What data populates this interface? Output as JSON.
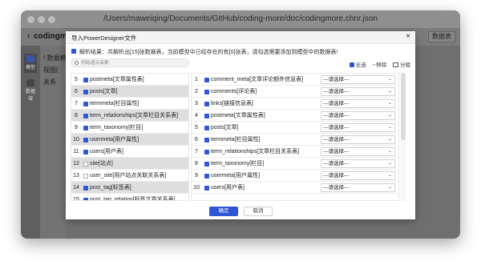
{
  "window": {
    "title": "/Users/maweiqing/Documents/GitHub/coding-more/doc/codingmore.chnr.json"
  },
  "app": {
    "name": "codingmo",
    "back_glyph": "‹",
    "header_button": "数据表",
    "rail": [
      {
        "label": "模型"
      },
      {
        "label": "数据域"
      }
    ],
    "tree": [
      "! 数据模",
      "视图(",
      "关系"
    ]
  },
  "modal": {
    "title": "导入PowerDesigner文件",
    "close_glyph": "×",
    "result_text": "解析结果：共解析出[15]张数据表，当前模型中已经存在的有[0]张表，请勾选需要添加到模型中的数据表!",
    "search_placeholder": "代码/显示名称",
    "select_all_label": "全选",
    "remove_label": "移除",
    "group_label": "分组",
    "ok_label": "确定",
    "cancel_label": "取消",
    "select_placeholder": "---请选择---",
    "left_rows": [
      {
        "index": "5",
        "checked": true,
        "name": "postmeta[文章属性表]",
        "selected": false
      },
      {
        "index": "6",
        "checked": true,
        "name": "posts[文章]",
        "selected": true
      },
      {
        "index": "7",
        "checked": true,
        "name": "termmeta[栏目属性]",
        "selected": false
      },
      {
        "index": "8",
        "checked": true,
        "name": "term_relationships[文章栏目关系表]",
        "selected": true
      },
      {
        "index": "9",
        "checked": true,
        "name": "term_taxonomy[栏目]",
        "selected": false
      },
      {
        "index": "10",
        "checked": true,
        "name": "usermeta[用户属性]",
        "selected": true
      },
      {
        "index": "11",
        "checked": true,
        "name": "users[用户表]",
        "selected": false
      },
      {
        "index": "12",
        "checked": false,
        "name": "site[站点]",
        "selected": true
      },
      {
        "index": "13",
        "checked": false,
        "name": "user_site[用户站点关联关系表]",
        "selected": false
      },
      {
        "index": "14",
        "checked": true,
        "name": "post_tag[标签表]",
        "selected": true
      },
      {
        "index": "15",
        "checked": true,
        "name": "post_tag_relation[标签文章关系表]",
        "selected": false
      }
    ],
    "right_rows": [
      {
        "index": "1",
        "checked": true,
        "name": "comment_meta[文章评论额外信息表]"
      },
      {
        "index": "2",
        "checked": true,
        "name": "comments[评论表]"
      },
      {
        "index": "3",
        "checked": true,
        "name": "links[链接信息表]"
      },
      {
        "index": "4",
        "checked": true,
        "name": "postmeta[文章属性表]"
      },
      {
        "index": "5",
        "checked": true,
        "name": "posts[文章]"
      },
      {
        "index": "6",
        "checked": true,
        "name": "termmeta[栏目属性]"
      },
      {
        "index": "7",
        "checked": true,
        "name": "term_relationships[文章栏目关系表]"
      },
      {
        "index": "8",
        "checked": true,
        "name": "term_taxonomy[栏目]"
      },
      {
        "index": "9",
        "checked": true,
        "name": "usermeta[用户属性]"
      },
      {
        "index": "10",
        "checked": true,
        "name": "users[用户表]"
      }
    ]
  },
  "colors": {
    "accent": "#2e57d6",
    "overlay": "#6f6f6f"
  }
}
